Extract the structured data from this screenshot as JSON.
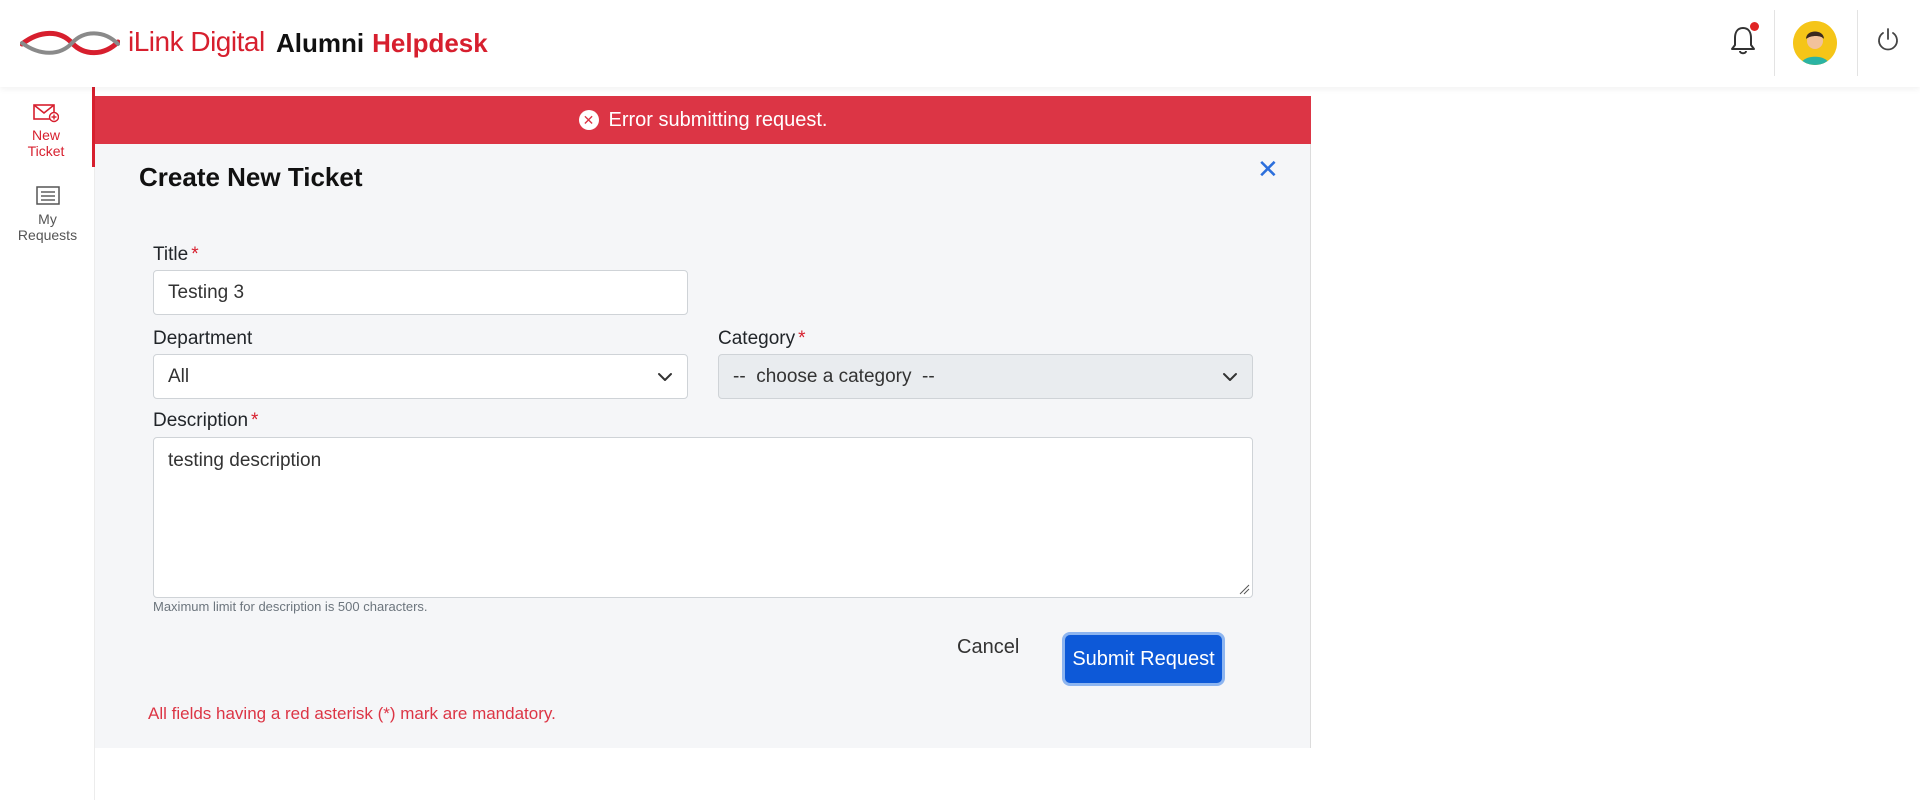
{
  "header": {
    "brand": "iLink Digital",
    "app_title_part1": "Alumni",
    "app_title_part2": "Helpdesk",
    "brand_color": "#d71f2e"
  },
  "sidebar": {
    "items": [
      {
        "label_line1": "New",
        "label_line2": "Ticket",
        "icon": "envelope-plus-icon",
        "active": true
      },
      {
        "label_line1": "My",
        "label_line2": "Requests",
        "icon": "list-icon",
        "active": false
      }
    ]
  },
  "alert": {
    "message": "Error submitting request.",
    "color": "#dc3545"
  },
  "form": {
    "title": "Create New Ticket",
    "title_field": {
      "label": "Title",
      "required_mark": "*",
      "value": "Testing 3"
    },
    "department_field": {
      "label": "Department",
      "value": "All"
    },
    "category_field": {
      "label": "Category",
      "required_mark": "*",
      "value": "--  choose a category  --"
    },
    "description_field": {
      "label": "Description",
      "required_mark": "*",
      "value": "testing description",
      "hint": "Maximum limit for description is 500 characters."
    },
    "cancel_label": "Cancel",
    "submit_label": "Submit Request",
    "mandatory_note": "All fields having a red asterisk (*) mark are mandatory.",
    "primary_color": "#0d59d8"
  }
}
